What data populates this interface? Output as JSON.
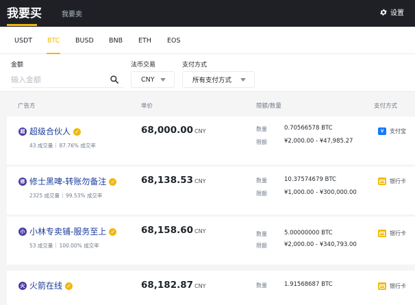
{
  "header": {
    "buy_tab": "我要买",
    "sell_tab": "我要卖",
    "settings_label": "设置"
  },
  "coins": [
    "USDT",
    "BTC",
    "BUSD",
    "BNB",
    "ETH",
    "EOS"
  ],
  "active_coin": "BTC",
  "filters": {
    "amount_label": "金额",
    "amount_placeholder": "输入金额",
    "fiat_label": "法币交易",
    "fiat_value": "CNY",
    "payment_label": "支付方式",
    "payment_value": "所有支付方式"
  },
  "columns": {
    "advertiser": "广告方",
    "price": "单价",
    "limit": "限额/数量",
    "payment": "支付方式"
  },
  "labels": {
    "qty": "数量",
    "limit": "限额"
  },
  "currency": "CNY",
  "colors": {
    "accent": "#f0b90b",
    "link": "#1c3c9c",
    "header_bg": "#1e2026"
  },
  "rows": [
    {
      "avatar": "超",
      "name": "超级合伙人",
      "orders": "43 成交量",
      "rate": "87.76% 成交率",
      "price": "68,000.00",
      "qty": "0.70566578 BTC",
      "limit": "¥2,000.00 - ¥47,985.27",
      "payment": "支付宝",
      "payment_icon": "alipay-icon"
    },
    {
      "avatar": "修",
      "name": "修士黑啤-转账勿备注",
      "orders": "2325 成交量",
      "rate": "99.53% 成交率",
      "price": "68,138.53",
      "qty": "10.37574679 BTC",
      "limit": "¥1,000.00 - ¥300,000.00",
      "payment": "银行卡",
      "payment_icon": "bank-card-icon"
    },
    {
      "avatar": "小",
      "name": "小林专卖铺-服务至上",
      "orders": "53 成交量",
      "rate": "100.00% 成交率",
      "price": "68,158.60",
      "qty": "5.00000000 BTC",
      "limit": "¥2,000.00 - ¥340,793.00",
      "payment": "银行卡",
      "payment_icon": "bank-card-icon"
    },
    {
      "avatar": "火",
      "name": "火箭在线",
      "price": "68,182.87",
      "qty": "1.91568687 BTC",
      "payment": "银行卡",
      "payment_icon": "bank-card-icon"
    }
  ]
}
